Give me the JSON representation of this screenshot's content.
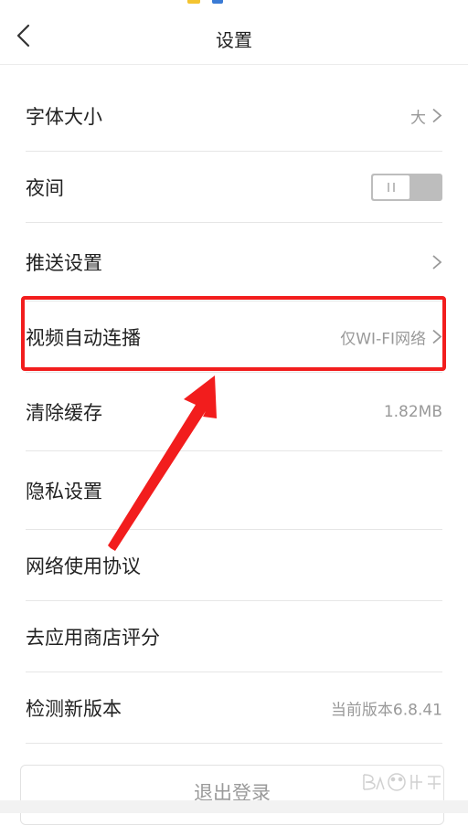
{
  "header": {
    "title": "设置"
  },
  "settings": {
    "font_size": {
      "label": "字体大小",
      "value": "大"
    },
    "night": {
      "label": "夜间",
      "enabled": false
    },
    "push": {
      "label": "推送设置"
    },
    "autoplay": {
      "label": "视频自动连播",
      "value": "仅WI-FI网络"
    },
    "cache": {
      "label": "清除缓存",
      "value": "1.82MB"
    },
    "privacy": {
      "label": "隐私设置"
    },
    "agreement": {
      "label": "网络使用协议"
    },
    "rate": {
      "label": "去应用商店评分"
    },
    "version": {
      "label": "检测新版本",
      "value": "当前版本6.8.41"
    }
  },
  "logout": {
    "label": "退出登录"
  },
  "colors": {
    "annotation": "#f21d1d",
    "value_text": "#999999",
    "divider": "#e6e6e6"
  },
  "icons": {
    "back": "chevron-left-icon",
    "row": "chevron-right-icon"
  }
}
